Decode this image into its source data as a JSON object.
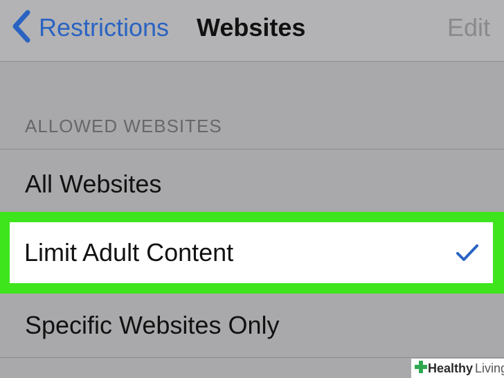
{
  "navbar": {
    "back_label": "Restrictions",
    "title": "Websites",
    "edit_label": "Edit"
  },
  "section": {
    "header": "ALLOWED WEBSITES"
  },
  "options": [
    {
      "label": "All Websites",
      "selected": false
    },
    {
      "label": "Limit Adult Content",
      "selected": true
    },
    {
      "label": "Specific Websites Only",
      "selected": false
    }
  ],
  "watermark": {
    "brand_bold": "Healthy",
    "brand_light": "Living"
  },
  "colors": {
    "accent": "#2a63c2",
    "highlight": "#3ee51c",
    "background": "#a9a9ab"
  },
  "icons": {
    "back": "chevron-left-icon",
    "selected": "checkmark-icon",
    "watermark": "cross-icon"
  }
}
